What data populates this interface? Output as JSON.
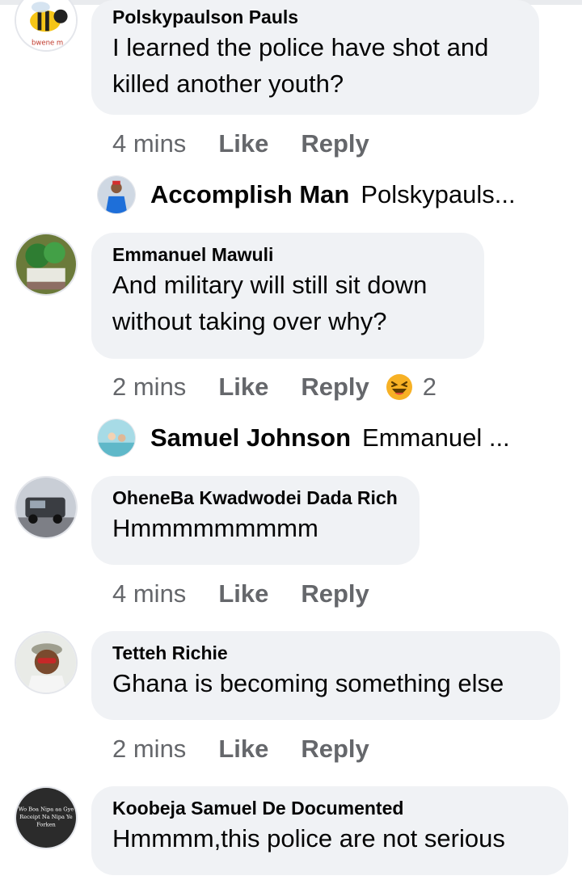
{
  "comments": [
    {
      "author": "Polskypaulson Pauls",
      "text_lines": [
        "I learned the police have shot and",
        "killed another youth?"
      ],
      "time": "4 mins",
      "like": "Like",
      "reply": "Reply",
      "avatar_icon": "bee-avatar",
      "reply_preview": {
        "name": "Accomplish Man",
        "snippet": "Polskypauls...",
        "avatar_icon": "person-avatar"
      }
    },
    {
      "author": "Emmanuel Mawuli",
      "text_lines": [
        "And military will still sit down",
        "without taking over why?"
      ],
      "time": "2 mins",
      "like": "Like",
      "reply": "Reply",
      "reaction": {
        "icon": "laughing-emoji-icon",
        "count": "2"
      },
      "avatar_icon": "plant-avatar",
      "reply_preview": {
        "name": "Samuel Johnson",
        "snippet": "Emmanuel ...",
        "avatar_icon": "beach-avatar"
      }
    },
    {
      "author": "OheneBa Kwadwodei Dada Rich",
      "text_lines": [
        "Hmmmmmmmmm"
      ],
      "time": "4 mins",
      "like": "Like",
      "reply": "Reply",
      "avatar_icon": "car-avatar"
    },
    {
      "author": "Tetteh Richie",
      "text_lines": [
        "Ghana is becoming something else"
      ],
      "time": "2 mins",
      "like": "Like",
      "reply": "Reply",
      "avatar_icon": "man-avatar"
    },
    {
      "author": "Koobeja Samuel De Documented",
      "text_lines": [
        "Hmmmm,this police are not serious"
      ],
      "avatar_icon": "text-avatar",
      "avatar_text": [
        "Wo Boa Nipa aa Gye",
        "Receipt Na Nipa Ye",
        "Forken"
      ]
    }
  ],
  "colors": {
    "bubble": "#f0f2f5",
    "meta": "#65676b",
    "text": "#050505"
  }
}
